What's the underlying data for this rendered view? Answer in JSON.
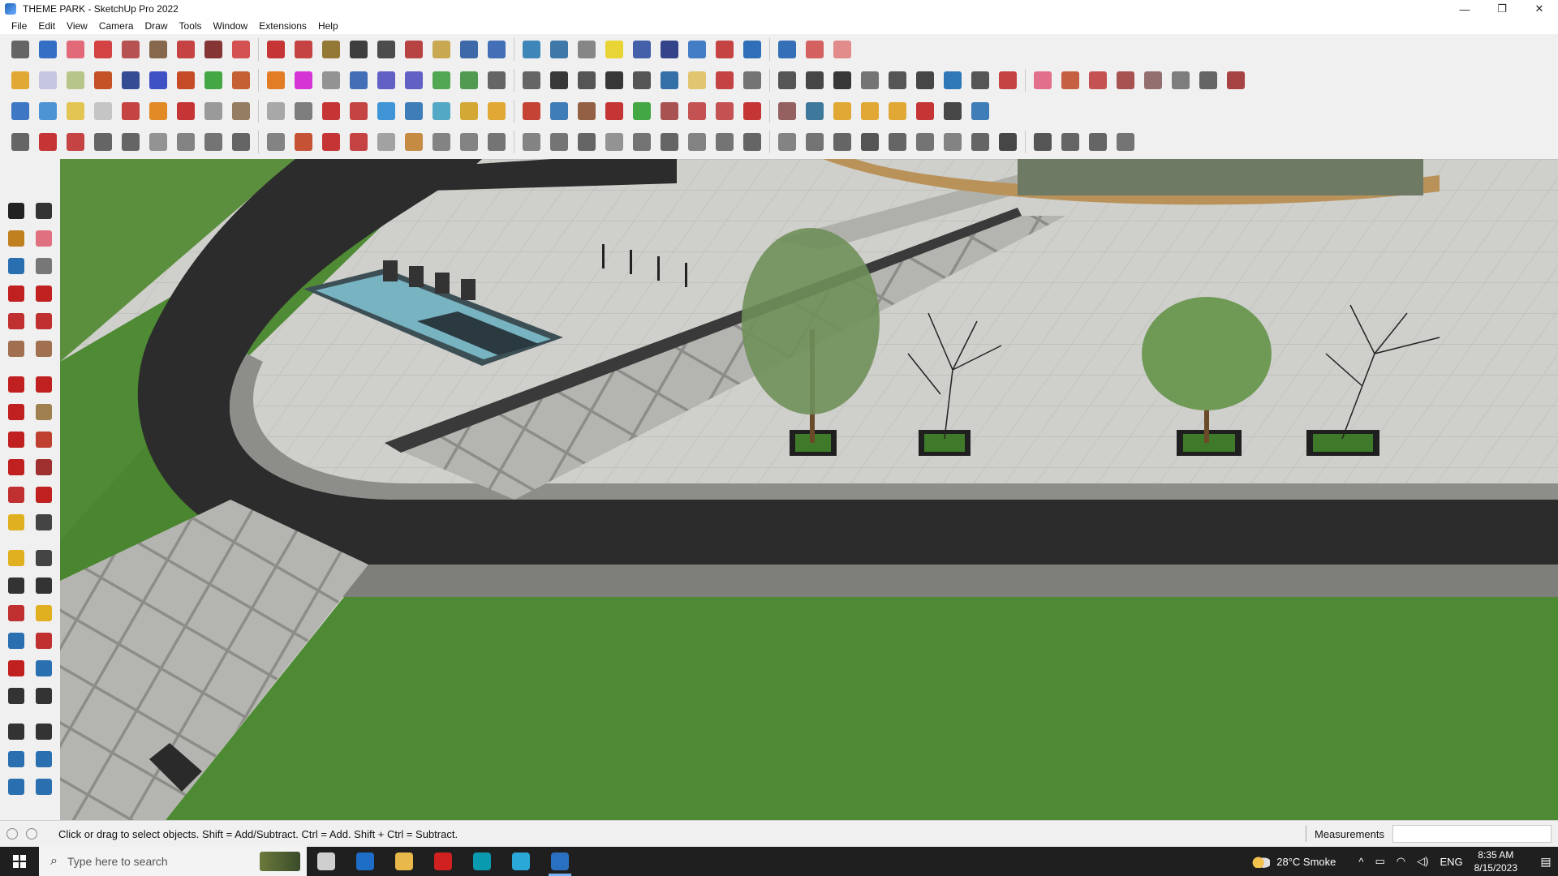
{
  "window": {
    "title": "THEME PARK - SketchUp Pro 2022"
  },
  "window_controls": {
    "minimize": "—",
    "restore": "❐",
    "close": "✕"
  },
  "menu": {
    "items": [
      "File",
      "Edit",
      "View",
      "Camera",
      "Draw",
      "Tools",
      "Window",
      "Extensions",
      "Help"
    ]
  },
  "toolbar": {
    "row1_colors": [
      "#555",
      "#2060c0",
      "#e05a6a",
      "#d03030",
      "#b04040",
      "#7a5a3a",
      "#c03030",
      "#7a2020",
      "#d04040",
      "#c02020",
      "#c03030",
      "#8a6a20",
      "#2a2a2a",
      "#3a3a3a",
      "#b03030",
      "#c4a040",
      "#2a5aa0",
      "#3060b0",
      "#2a7ab0",
      "#2a6aa0",
      "#7a7a7a",
      "#e8d020",
      "#3050a0",
      "#203080",
      "#3070c0",
      "#c03030",
      "#1a60b0",
      "#2060b0",
      "#d05050",
      "#e08080"
    ],
    "row2_colors": [
      "#e0a020",
      "#c0c0e0",
      "#b0c080",
      "#c04010",
      "#203a8a",
      "#2a40c0",
      "#c03a10",
      "#30a030",
      "#c05020",
      "#e07010",
      "#d020d0",
      "#888888",
      "#3060b0",
      "#5050c0",
      "#5050c0",
      "#40a040",
      "#409040",
      "#555",
      "#555",
      "#222",
      "#444",
      "#222",
      "#444",
      "#2060a0",
      "#e0c060",
      "#c03030",
      "#666",
      "#444",
      "#333",
      "#222",
      "#666",
      "#444",
      "#333",
      "#1a6ab0",
      "#444",
      "#c03030",
      "#e06080",
      "#c05030",
      "#c04040",
      "#a04040",
      "#8a6060",
      "#707070",
      "#555",
      "#a03030"
    ],
    "row3_colors": [
      "#2a6ac0",
      "#3a8ad0",
      "#e0c040",
      "#c0c0c0",
      "#c03030",
      "#e08010",
      "#c02020",
      "#909090",
      "#8a7050",
      "#a0a0a0",
      "#707070",
      "#c02020",
      "#c03030",
      "#2a8ad0",
      "#2a70b0",
      "#40a0c0",
      "#d0a020",
      "#e0a020",
      "#c03020",
      "#2a70b0",
      "#8a5030",
      "#c02020",
      "#30a030",
      "#a04040",
      "#c04040",
      "#c04040",
      "#c02020",
      "#8a5050",
      "#2a6a90",
      "#e0a020",
      "#e0a020",
      "#e0a020",
      "#c02020",
      "#333",
      "#2a70b0"
    ],
    "row4_colors": [
      "#555",
      "#c02020",
      "#c03030",
      "#555",
      "#555",
      "#888",
      "#777",
      "#666",
      "#555",
      "#777",
      "#c04020",
      "#c02020",
      "#c03030",
      "#999",
      "#c08030",
      "#777",
      "#777",
      "#666",
      "#777",
      "#666",
      "#555",
      "#888",
      "#666",
      "#555",
      "#777",
      "#666",
      "#555",
      "#777",
      "#666",
      "#555",
      "#444",
      "#555",
      "#666",
      "#777",
      "#555",
      "#333",
      "#444",
      "#555",
      "#555",
      "#666"
    ]
  },
  "palette": {
    "icons": [
      [
        "select-icon",
        "#222"
      ],
      [
        "orbit-icon",
        "#333"
      ],
      [
        "paint-bucket-icon",
        "#c08020"
      ],
      [
        "eraser-icon",
        "#e07080"
      ],
      [
        "tape-measure-icon",
        "#2a70b0"
      ],
      [
        "pencil-tag-icon",
        "#777"
      ],
      [
        "line-icon",
        "#c02020"
      ],
      [
        "freehand-icon",
        "#c02020"
      ],
      [
        "rectangle-icon",
        "#c03030"
      ],
      [
        "rotated-rectangle-icon",
        "#c03030"
      ],
      [
        "circle-icon",
        "#a07050"
      ],
      [
        "polygon-icon",
        "#a07050"
      ],
      [
        "arc-icon",
        "#c02020"
      ],
      [
        "two-point-arc-icon",
        "#c02020"
      ],
      [
        "three-point-arc-icon",
        "#c02020"
      ],
      [
        "pie-icon",
        "#a08050"
      ],
      [
        "move-icon",
        "#c02020"
      ],
      [
        "push-pull-icon",
        "#c04030"
      ],
      [
        "rotate-icon",
        "#c02020"
      ],
      [
        "follow-me-icon",
        "#a03030"
      ],
      [
        "scale-icon",
        "#c03030"
      ],
      [
        "offset-icon",
        "#c02020"
      ],
      [
        "tape-icon",
        "#e0b020"
      ],
      [
        "dimension-icon",
        "#444"
      ],
      [
        "protractor-icon",
        "#e0b020"
      ],
      [
        "text-icon",
        "#444"
      ],
      [
        "axes-icon",
        "#333"
      ],
      [
        "3d-text-icon",
        "#333"
      ],
      [
        "orbit-tool-icon",
        "#c03030"
      ],
      [
        "pan-icon",
        "#e0b020"
      ],
      [
        "zoom-icon",
        "#2a70b0"
      ],
      [
        "zoom-window-icon",
        "#c03030"
      ],
      [
        "zoom-extents-icon",
        "#c02020"
      ],
      [
        "previous-view-icon",
        "#2a70b0"
      ],
      [
        "position-camera-icon",
        "#333"
      ],
      [
        "look-around-icon",
        "#333"
      ],
      [
        "walk-icon",
        "#333"
      ],
      [
        "section-plane-icon",
        "#333"
      ],
      [
        "warehouse-icon",
        "#2a70b0"
      ],
      [
        "extension-icon",
        "#2a70b0"
      ],
      [
        "layers-icon",
        "#2a70b0"
      ],
      [
        "styles-icon",
        "#2a70b0"
      ]
    ]
  },
  "status": {
    "hint": "Click or drag to select objects. Shift = Add/Subtract. Ctrl = Add. Shift + Ctrl = Subtract.",
    "measurements_label": "Measurements",
    "measurements_value": ""
  },
  "taskbar": {
    "search_placeholder": "Type here to search",
    "apps": [
      [
        "task-view-icon",
        "#cfcfcf"
      ],
      [
        "calculator-icon",
        "#1e6ec8"
      ],
      [
        "file-explorer-icon",
        "#e8b84a"
      ],
      [
        "acrobat-icon",
        "#d02020"
      ],
      [
        "3ds-max-icon",
        "#0a9ab0"
      ],
      [
        "edge-icon",
        "#2aa8d8"
      ],
      [
        "sketchup-icon",
        "#2a70c0"
      ]
    ],
    "weather": "28°C  Smoke",
    "language": "ENG",
    "time": "8:35 AM",
    "date": "8/15/2023"
  }
}
